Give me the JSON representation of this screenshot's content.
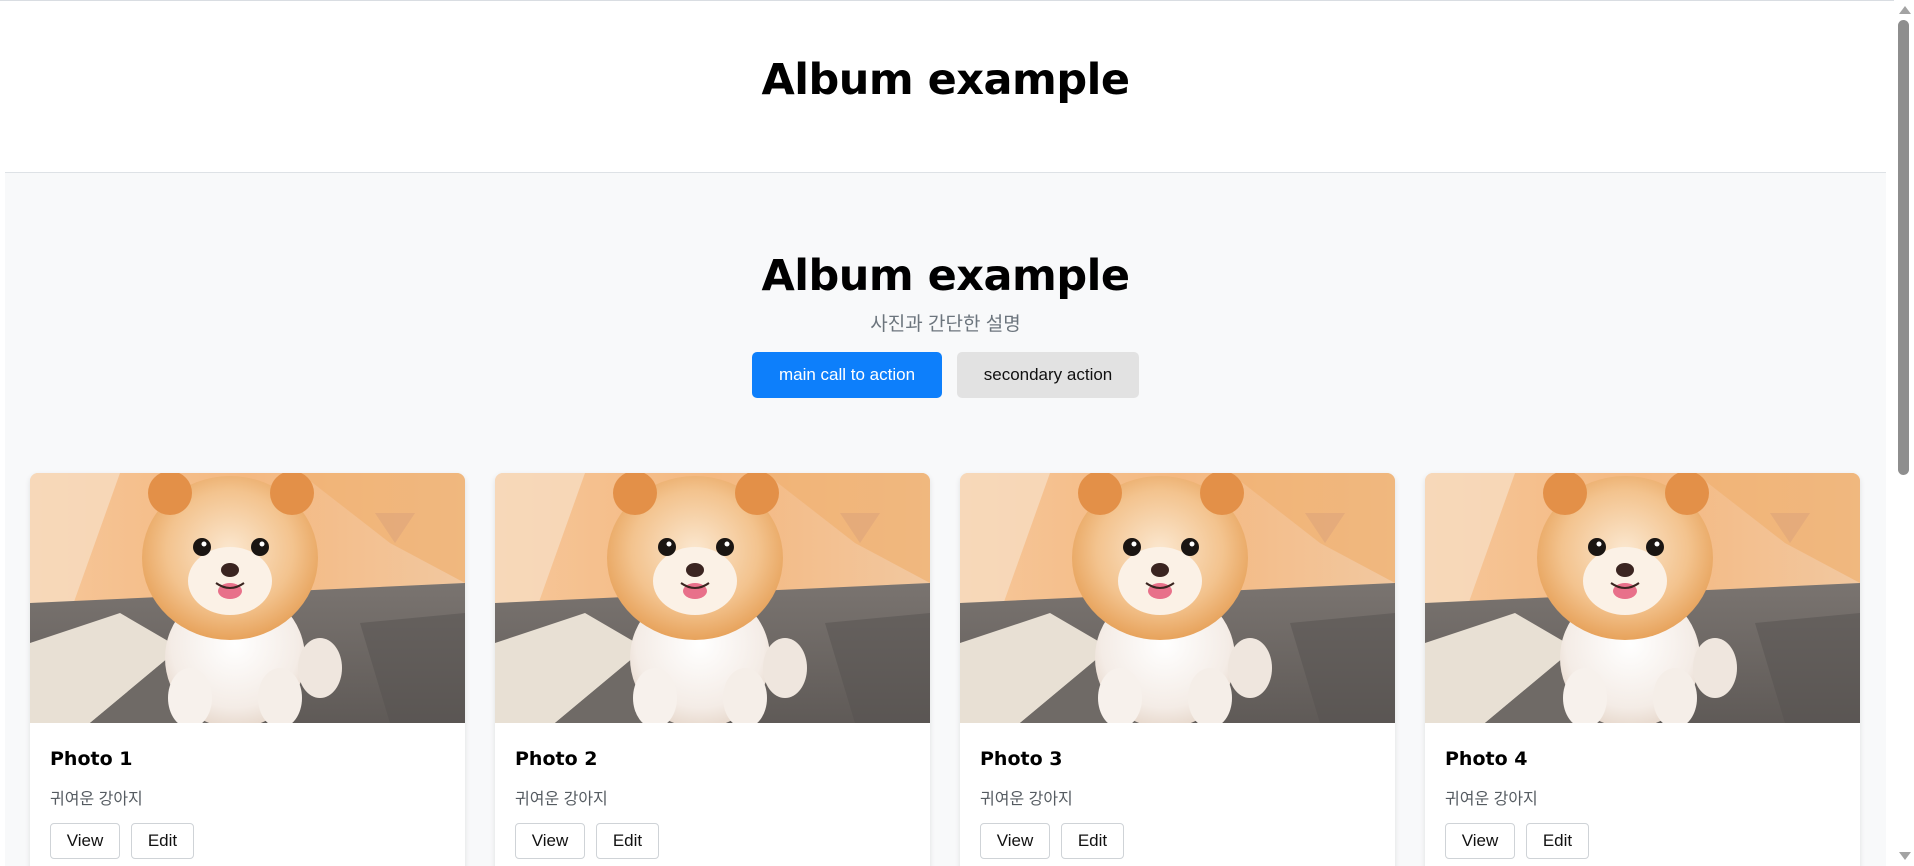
{
  "header": {
    "title": "Album example"
  },
  "hero": {
    "title": "Album example",
    "lead": "사진과 간단한 설명",
    "primary_label": "main call to action",
    "secondary_label": "secondary action"
  },
  "cards": [
    {
      "title": "Photo 1",
      "text": "귀여운 강아지",
      "view_label": "View",
      "edit_label": "Edit"
    },
    {
      "title": "Photo 2",
      "text": "귀여운 강아지",
      "view_label": "View",
      "edit_label": "Edit"
    },
    {
      "title": "Photo 3",
      "text": "귀여운 강아지",
      "view_label": "View",
      "edit_label": "Edit"
    },
    {
      "title": "Photo 4",
      "text": "귀여운 강아지",
      "view_label": "View",
      "edit_label": "Edit"
    }
  ],
  "colors": {
    "primary": "#0d7ffb",
    "secondary": "#e2e2e2",
    "background": "#f8f9fa"
  }
}
